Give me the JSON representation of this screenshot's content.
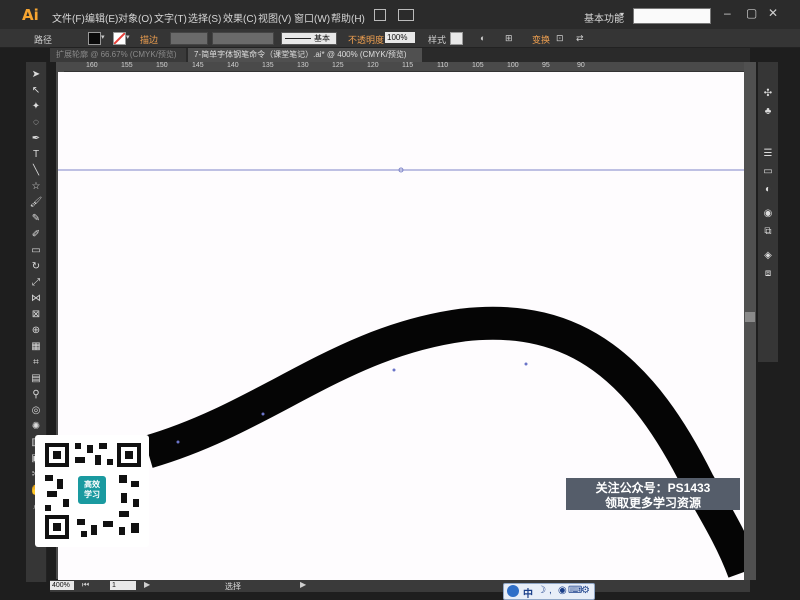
{
  "app": {
    "logo": "Ai",
    "menus": [
      "文件(F)",
      "编辑(E)",
      "对象(O)",
      "文字(T)",
      "选择(S)",
      "效果(C)",
      "视图(V)",
      "窗口(W)",
      "帮助(H)"
    ],
    "workspace": "基本功能",
    "search_placeholder": ""
  },
  "control_bar": {
    "object_label": "路径",
    "stroke_label": "描边",
    "stroke_style": "基本",
    "opacity_label": "不透明度",
    "opacity_value": "100%",
    "style_label": "样式",
    "transform_label": "变换",
    "fill_color": "#0a0a0a",
    "stroke_color": "#e8403a"
  },
  "tabs": [
    {
      "label": "扩展轮廓 @ 66.67% (CMYK/预览)",
      "active": false
    },
    {
      "label": "7-简单字体钢笔命令（课堂笔记）.ai* @ 400% (CMYK/预览)",
      "active": true
    }
  ],
  "ruler": {
    "ticks": [
      "160",
      "155",
      "150",
      "145",
      "140",
      "135",
      "130",
      "125",
      "120",
      "115",
      "110",
      "105",
      "100",
      "95",
      "90"
    ]
  },
  "status_bar": {
    "zoom": "400%",
    "artboard": "1",
    "selection_label": "选择"
  },
  "overlay": {
    "qr_badge": "高效学习",
    "promo_line1": "关注公众号：PS1433",
    "promo_line2": "领取更多学习资源"
  },
  "ime": {
    "lang": "中"
  },
  "colors": {
    "accent": "#f7a531",
    "guide": "#7d84c8",
    "curve": "#050505"
  }
}
